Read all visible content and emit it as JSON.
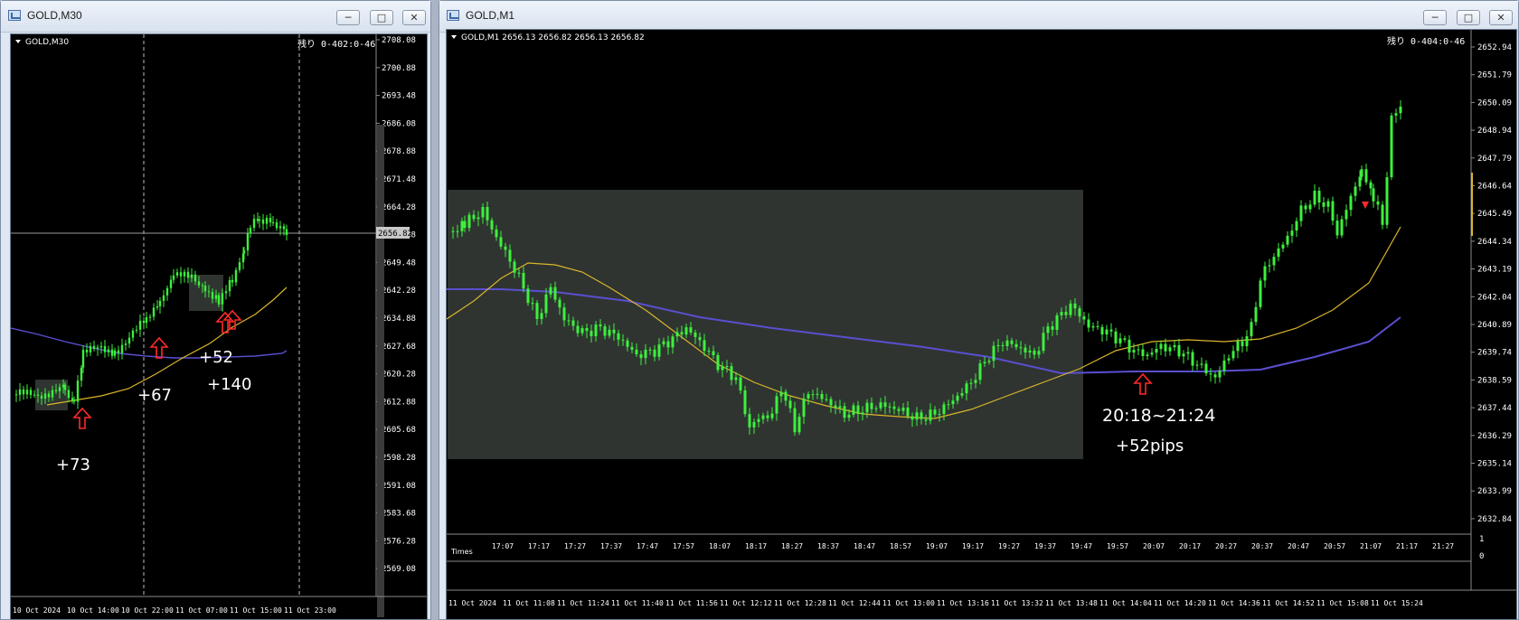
{
  "left_window": {
    "title": "GOLD,M30",
    "controls": {
      "minimize": "─",
      "maximize": "□",
      "close": "✕"
    },
    "chart_header": "GOLD,M30",
    "timer": "残り 0-402:0-46",
    "current_price": "2656.82",
    "price_ticks": [
      "2708.08",
      "2700.88",
      "2693.48",
      "2686.08",
      "2678.88",
      "2671.48",
      "2664.28",
      "2656.88",
      "2649.48",
      "2642.28",
      "2634.88",
      "2627.68",
      "2620.28",
      "2612.88",
      "2605.68",
      "2598.28",
      "2591.08",
      "2583.68",
      "2576.28",
      "2569.08"
    ],
    "date_ticks": [
      "10 Oct 2024",
      "10 Oct 14:00",
      "10 Oct 22:00",
      "11 Oct 07:00",
      "11 Oct 15:00",
      "11 Oct 23:00"
    ],
    "annotations": [
      "+73",
      "+67",
      "+52",
      "+140"
    ]
  },
  "right_window": {
    "title": "GOLD,M1",
    "controls": {
      "minimize": "─",
      "maximize": "□",
      "close": "✕"
    },
    "chart_header": "GOLD,M1  2656.13 2656.82 2656.13 2656.82",
    "timer": "残り 0-404:0-46",
    "price_ticks": [
      "2652.94",
      "2651.79",
      "2650.09",
      "2648.94",
      "2647.79",
      "2646.64",
      "2645.49",
      "2644.34",
      "2643.19",
      "2642.04",
      "2640.89",
      "2639.74",
      "2638.59",
      "2637.44",
      "2636.29",
      "2635.14",
      "2633.99",
      "2632.84"
    ],
    "date_ticks": [
      "11 Oct 2024",
      "11 Oct 11:08",
      "11 Oct 11:24",
      "11 Oct 11:40",
      "11 Oct 11:56",
      "11 Oct 12:12",
      "11 Oct 12:28",
      "11 Oct 12:44",
      "11 Oct 13:00",
      "11 Oct 13:16",
      "11 Oct 13:32",
      "11 Oct 13:48",
      "11 Oct 14:04",
      "11 Oct 14:20",
      "11 Oct 14:36",
      "11 Oct 14:52",
      "11 Oct 15:08",
      "11 Oct 15:24"
    ],
    "indicator": {
      "label": "Times",
      "ticks": [
        "17:07",
        "17:17",
        "17:27",
        "17:37",
        "17:47",
        "17:57",
        "18:07",
        "18:17",
        "18:27",
        "18:37",
        "18:47",
        "18:57",
        "19:07",
        "19:17",
        "19:27",
        "19:37",
        "19:47",
        "19:57",
        "20:07",
        "20:17",
        "20:27",
        "20:37",
        "20:47",
        "20:57",
        "21:07",
        "21:17",
        "21:27"
      ],
      "scale": [
        "1",
        "0"
      ]
    },
    "annotations": [
      "20:18~21:24",
      "+52pips"
    ]
  },
  "colors": {
    "chart_bg": "#000000",
    "candle": "#3df03d",
    "ma_fast": "#d9b52b",
    "ma_slow": "#5a4fd0",
    "arrow": "#ff2a2a",
    "highlight_box": "#2f3431",
    "text": "#ffffff"
  }
}
